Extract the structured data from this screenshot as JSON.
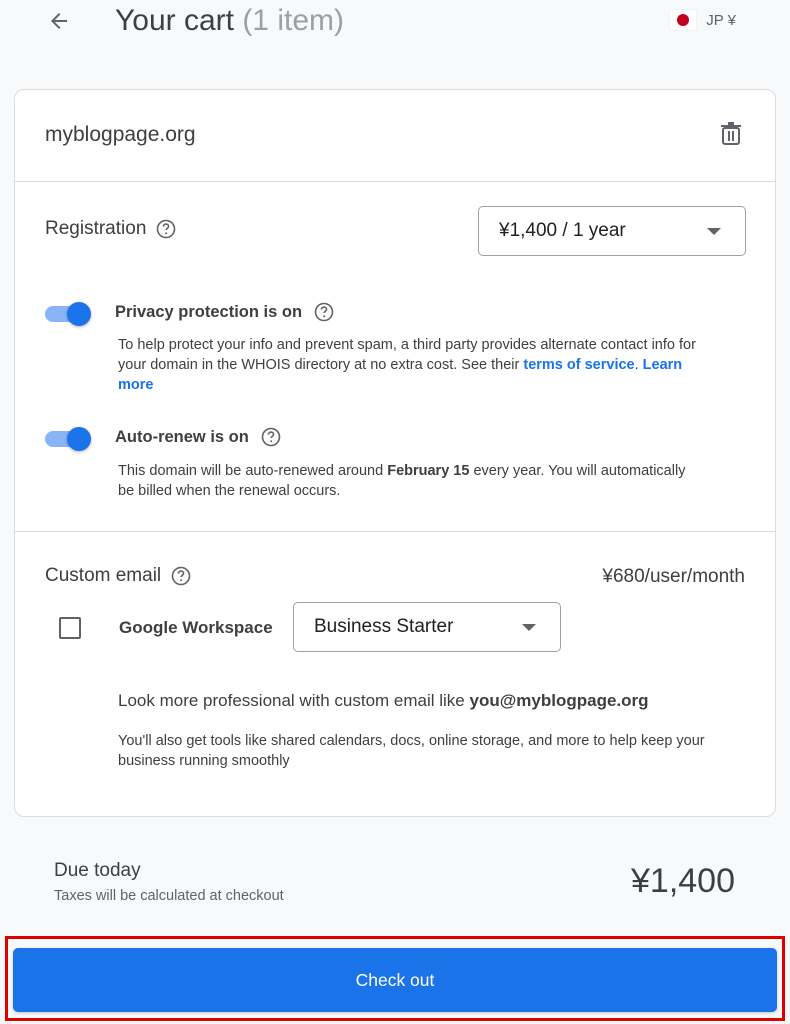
{
  "header": {
    "title": "Your cart",
    "item_count": "(1 item)",
    "currency_label": "JP ¥",
    "flag": "japan-flag"
  },
  "cart_item": {
    "domain": "myblogpage.org",
    "registration": {
      "label": "Registration",
      "selected_option": "¥1,400 / 1 year"
    },
    "privacy": {
      "label": "Privacy protection is on",
      "enabled": true,
      "desc_text": "To help protect your info and prevent spam, a third party provides alternate contact info for your domain in the WHOIS directory at no extra cost. See their",
      "terms_link": "terms of service",
      "learn_more_link": "Learn more"
    },
    "auto_renew": {
      "label": "Auto-renew is on",
      "enabled": true,
      "desc_pre": "This domain will be auto-renewed around",
      "desc_date": "February 15",
      "desc_post": "every year. You will automatically be billed when the renewal occurs."
    },
    "custom_email": {
      "label": "Custom email",
      "price": "¥680/user/month",
      "checkbox_checked": false,
      "workspace_label": "Google Workspace",
      "plan_selected": "Business Starter",
      "promo_pre": "Look more professional with custom email like",
      "promo_email": "you@myblogpage.org",
      "promo_desc": "You'll also get tools like shared calendars, docs, online storage, and more to help keep your business running smoothly"
    }
  },
  "summary": {
    "due_label": "Due today",
    "tax_note": "Taxes will be calculated at checkout",
    "amount": "¥1,400"
  },
  "checkout": {
    "button_label": "Check out",
    "highlight_color": "#e00000"
  },
  "colors": {
    "accent": "#1a73e8",
    "toggle_track": "#8ab4f8"
  }
}
